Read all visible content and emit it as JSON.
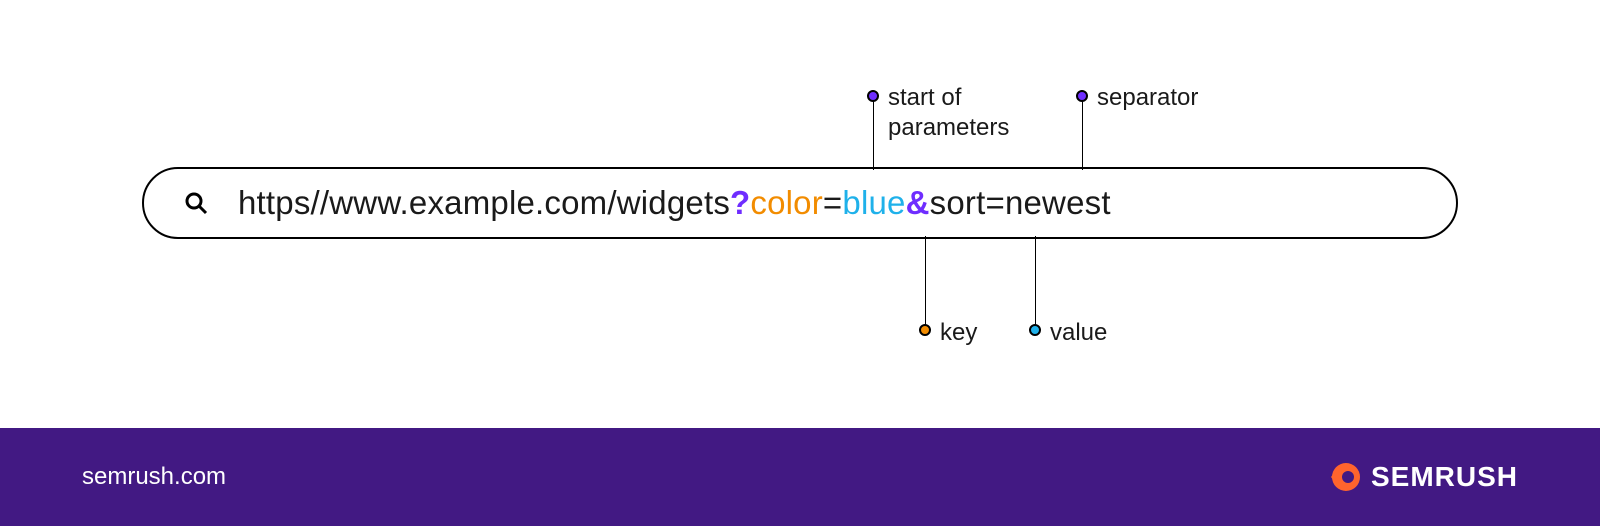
{
  "url": {
    "base": "https//www.example.com/widgets",
    "start_marker": "?",
    "key1": "color",
    "eq1": "=",
    "value1": "blue",
    "separator": "&",
    "rest": "sort=newest"
  },
  "annotations": {
    "start_of_parameters": "start of\nparameters",
    "separator_label": "separator",
    "key_label": "key",
    "value_label": "value"
  },
  "colors": {
    "purple": "#6f2dff",
    "orange": "#f28c00",
    "blue": "#1fb1ea",
    "footer_bg": "#421983"
  },
  "footer": {
    "domain": "semrush.com",
    "brand": "SEMRUSH"
  }
}
